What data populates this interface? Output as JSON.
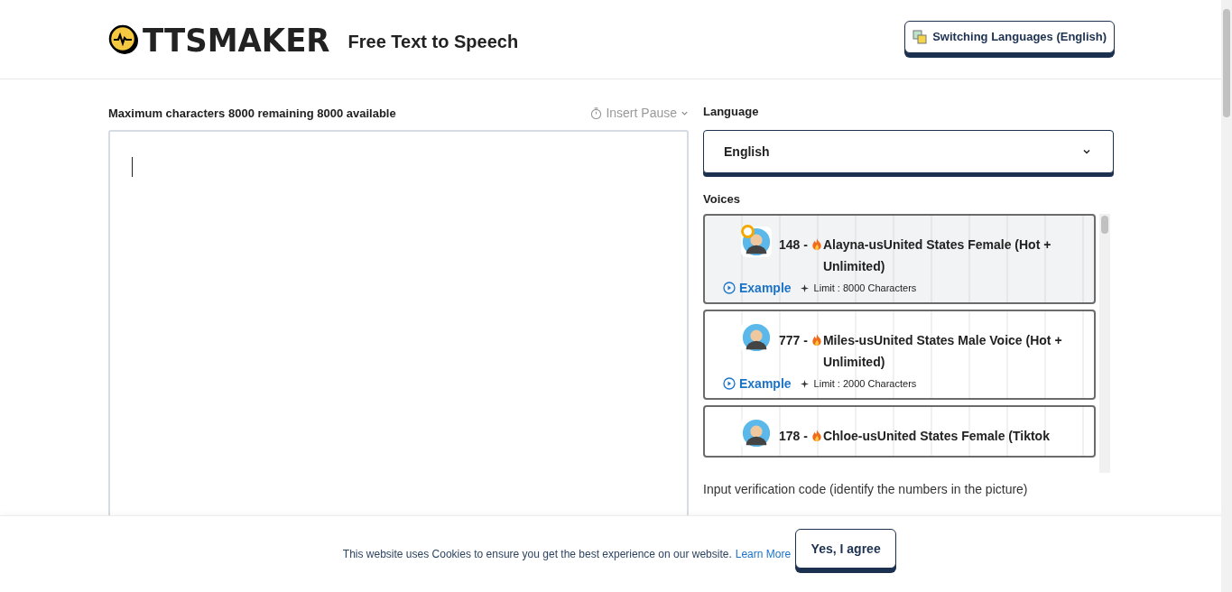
{
  "header": {
    "logo": "TTSMAKER",
    "tagline": "Free Text to Speech",
    "language_button": "Switching Languages (English)"
  },
  "editor": {
    "limit_label": "Maximum characters 8000 remaining 8000 available",
    "insert_pause": "Insert Pause"
  },
  "language": {
    "label": "Language",
    "value": "English"
  },
  "voices": {
    "label": "Voices",
    "items": [
      {
        "number": "148 -",
        "name": "Alayna-usUnited States Female (Hot + Unlimited)",
        "example": "Example",
        "limit": "Limit : 8000 Characters",
        "selected": true
      },
      {
        "number": "777 -",
        "name": "Miles-usUnited States Male Voice (Hot + Unlimited)",
        "example": "Example",
        "limit": "Limit : 2000 Characters",
        "selected": false
      },
      {
        "number": "178 -",
        "name": "Chloe-usUnited States Female (Tiktok",
        "selected": false
      }
    ]
  },
  "verification": {
    "label": "Input verification code (identify the numbers in the picture)"
  },
  "cookie": {
    "text": "This website uses Cookies to ensure you get the best experience on our website.",
    "link": "Learn More",
    "button": "Yes, I agree"
  }
}
